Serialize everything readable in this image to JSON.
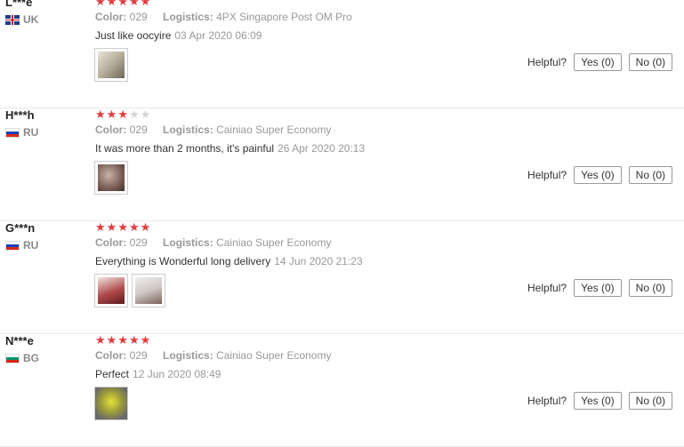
{
  "labels": {
    "color": "Color:",
    "logistics": "Logistics:",
    "helpful": "Helpful?",
    "yes": "Yes (0)",
    "no": "No (0)"
  },
  "colors": {
    "star_on": "#e4393c",
    "star_off": "#d6d6d6"
  },
  "reviews": [
    {
      "user": "L***e",
      "country": "UK",
      "flag": "uk-flag-icon",
      "rating": 5,
      "color": "029",
      "logistics": "4PX Singapore Post OM Pro",
      "text": "Just like oocyire",
      "date": "03 Apr 2020 06:09",
      "photos": 1
    },
    {
      "user": "H***h",
      "country": "RU",
      "flag": "ru-flag-icon",
      "rating": 3,
      "color": "029",
      "logistics": "Cainiao Super Economy",
      "text": "It was more than 2 months, it's painful",
      "date": "26 Apr 2020 20:13",
      "photos": 1
    },
    {
      "user": "G***n",
      "country": "RU",
      "flag": "ru-flag-icon",
      "rating": 5,
      "color": "029",
      "logistics": "Cainiao Super Economy",
      "text": "Everything is Wonderful long delivery",
      "date": "14 Jun 2020 21:23",
      "photos": 2
    },
    {
      "user": "N***e",
      "country": "BG",
      "flag": "bg-flag-icon",
      "rating": 5,
      "color": "029",
      "logistics": "Cainiao Super Economy",
      "text": "Perfect",
      "date": "12 Jun 2020 08:49",
      "photos": 1
    }
  ]
}
